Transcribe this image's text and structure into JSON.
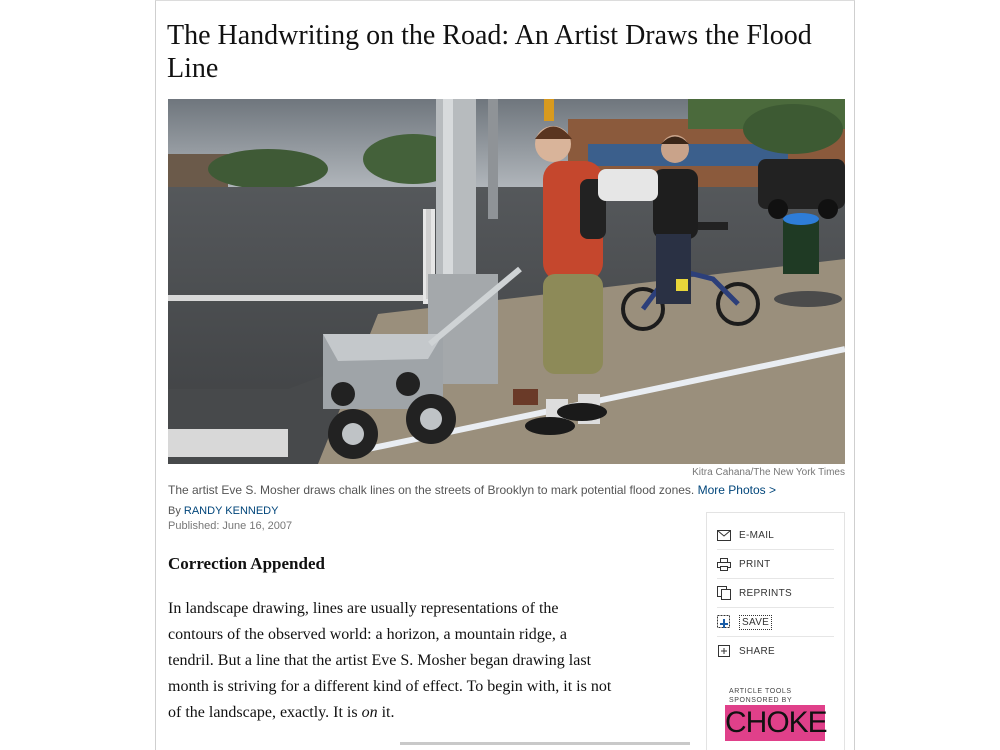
{
  "article": {
    "headline": "The Handwriting on the Road: An Artist Draws the Flood Line",
    "photo_credit": "Kitra Cahana/The New York Times",
    "caption_text": "The artist Eve S. Mosher draws chalk lines on the streets of Brooklyn to mark potential flood zones.",
    "caption_link": "More Photos >",
    "byline_prefix": "By",
    "author": "RANDY KENNEDY",
    "published": "Published: June 16, 2007",
    "correction_heading": "Correction Appended",
    "paragraph_lines": [
      "In landscape drawing, lines are usually representations of the",
      "contours of the observed world: a horizon, a mountain ridge, a",
      "tendril. But a line that the artist Eve S. Mosher began drawing last",
      "month is striving for a different kind of effect. To begin with, it is not"
    ],
    "last_line_before": "of the landscape, exactly. It is ",
    "last_line_emph": "on",
    "last_line_after": " it."
  },
  "tools": {
    "items": [
      {
        "label": "E-MAIL",
        "icon": "envelope-icon"
      },
      {
        "label": "PRINT",
        "icon": "printer-icon"
      },
      {
        "label": "REPRINTS",
        "icon": "reprints-icon"
      },
      {
        "label": "SAVE",
        "icon": "save-icon"
      },
      {
        "label": "SHARE",
        "icon": "share-icon"
      }
    ],
    "sponsor_label_line1": "ARTICLE TOOLS",
    "sponsor_label_line2": "SPONSORED BY",
    "sponsor_name": "CHOKE",
    "sponsor_color": "#e0408a"
  }
}
